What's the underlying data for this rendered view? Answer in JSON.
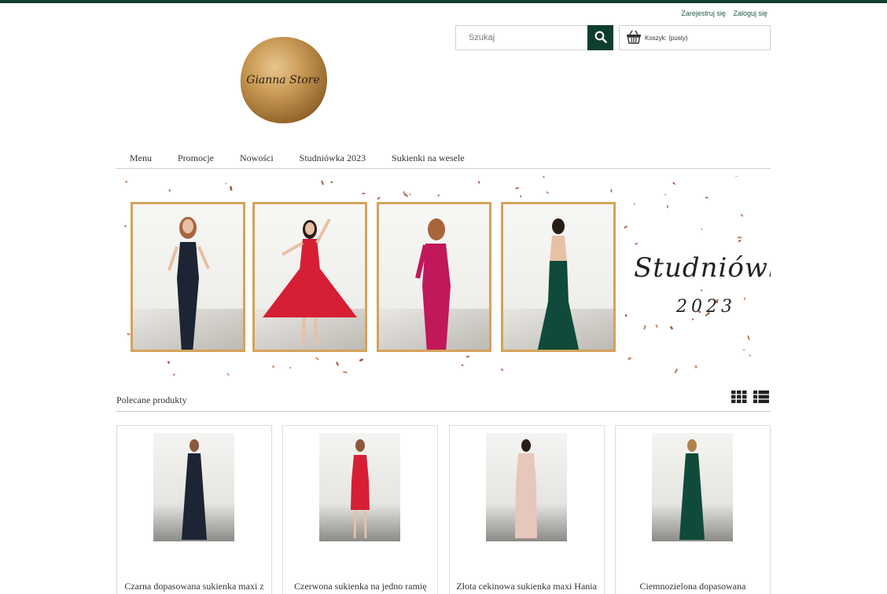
{
  "header": {
    "register_label": "Zarejestruj się",
    "login_label": "Zaloguj się",
    "search_placeholder": "Szukaj",
    "cart_label": "Koszyk: (pusty)",
    "logo_text": "Gianna Store",
    "accent_color": "#0f3d2e"
  },
  "nav": {
    "items": [
      {
        "label": "Menu"
      },
      {
        "label": "Promocje"
      },
      {
        "label": "Nowości"
      },
      {
        "label": "Studniówka 2023"
      },
      {
        "label": "Sukienki na wesele"
      }
    ]
  },
  "banner": {
    "title": "Studniówka",
    "year": "2023",
    "frame_color": "#d4a35b",
    "dress_colors": [
      "#1d2433",
      "#d61f34",
      "#c0185a",
      "#0f4a3a"
    ]
  },
  "featured": {
    "title": "Polecane produkty",
    "grid_view_icon": "grid-icon",
    "list_view_icon": "list-icon",
    "products": [
      {
        "name": "Czarna dopasowana sukienka maxi z",
        "dress_color": "#1d2433"
      },
      {
        "name": "Czerwona sukienka na jedno ramię",
        "dress_color": "#d61f34"
      },
      {
        "name": "Złota cekinowa sukienka maxi Hania",
        "dress_color": "#e7c7bb"
      },
      {
        "name": "Ciemnozielona dopasowana",
        "dress_color": "#0f4a3a"
      }
    ]
  }
}
